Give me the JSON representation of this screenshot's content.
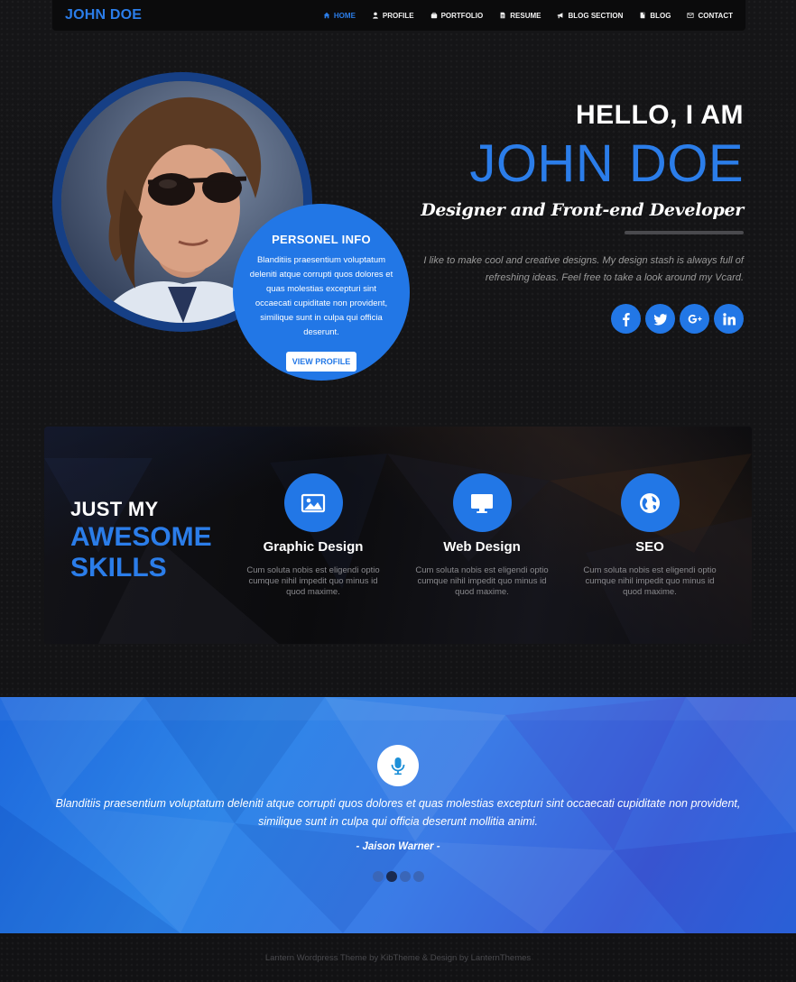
{
  "nav": {
    "brand": "JOHN DOE",
    "items": [
      {
        "label": "HOME",
        "icon": "home-icon",
        "active": true
      },
      {
        "label": "PROFILE",
        "icon": "user-icon",
        "active": false
      },
      {
        "label": "PORTFOLIO",
        "icon": "briefcase-icon",
        "active": false
      },
      {
        "label": "RESUME",
        "icon": "document-icon",
        "active": false
      },
      {
        "label": "BLOG SECTION",
        "icon": "megaphone-icon",
        "active": false
      },
      {
        "label": "BLOG",
        "icon": "book-icon",
        "active": false
      },
      {
        "label": "CONTACT",
        "icon": "envelope-icon",
        "active": false
      }
    ]
  },
  "hero": {
    "info_title": "PERSONEL INFO",
    "info_text": "Blanditiis praesentium voluptatum deleniti atque corrupti quos dolores et quas molestias excepturi sint occaecati cupiditate non provident, similique sunt in culpa qui officia deserunt.",
    "info_button": "VIEW PROFILE",
    "hello": "HELLO, I AM",
    "name": "JOHN DOE",
    "role": "Designer and Front-end Developer",
    "intro": "I like to make cool and creative designs. My design stash is always full of refreshing ideas. Feel free to take a look around my Vcard.",
    "socials": [
      "facebook-icon",
      "twitter-icon",
      "google-plus-icon",
      "linkedin-icon"
    ]
  },
  "skills": {
    "heading_line1": "JUST MY",
    "heading_line2": "AWESOME",
    "heading_line3": "SKILLS",
    "items": [
      {
        "title": "Graphic Design",
        "icon": "image-icon",
        "desc": "Cum soluta nobis est eligendi optio cumque nihil impedit quo minus id quod maxime."
      },
      {
        "title": "Web Design",
        "icon": "monitor-icon",
        "desc": "Cum soluta nobis est eligendi optio cumque nihil impedit quo minus id quod maxime."
      },
      {
        "title": "SEO",
        "icon": "globe-icon",
        "desc": "Cum soluta nobis est eligendi optio cumque nihil impedit quo minus id quod maxime."
      }
    ]
  },
  "testimonial": {
    "quote": "Blanditiis praesentium voluptatum deleniti atque corrupti quos dolores et quas molestias excepturi sint occaecati cupiditate non provident, similique sunt in culpa qui officia deserunt mollitia animi.",
    "author": "- Jaison Warner -",
    "active_slide": 2,
    "slide_count": 4
  },
  "footer": {
    "text": "Lantern Wordpress Theme by KibTheme & Design by LanternThemes"
  },
  "colors": {
    "accent": "#2277e6",
    "background": "#141416"
  }
}
